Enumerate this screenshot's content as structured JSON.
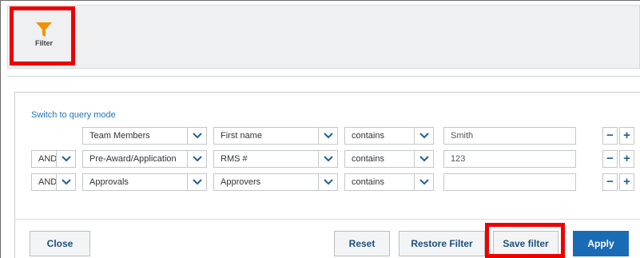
{
  "toolbar": {
    "filter_label": "Filter"
  },
  "query": {
    "switch_label": "Switch to query mode",
    "rows": [
      {
        "conj": "",
        "category": "Team Members",
        "field": "First name",
        "operator": "contains",
        "value": "Smith"
      },
      {
        "conj": "AND",
        "category": "Pre-Award/Application",
        "field": "RMS #",
        "operator": "contains",
        "value": "123"
      },
      {
        "conj": "AND",
        "category": "Approvals",
        "field": "Approvers",
        "operator": "contains",
        "value": ""
      }
    ],
    "minus_symbol": "−",
    "plus_symbol": "+"
  },
  "footer": {
    "close": "Close",
    "reset": "Reset",
    "restore": "Restore Filter",
    "save": "Save filter",
    "apply": "Apply"
  },
  "colors": {
    "accent": "#1a6bb5",
    "highlight": "#ee0000",
    "filter_icon": "#f39200"
  },
  "icons": {
    "filter": "funnel-icon",
    "dropdown": "chevron-down-icon"
  }
}
